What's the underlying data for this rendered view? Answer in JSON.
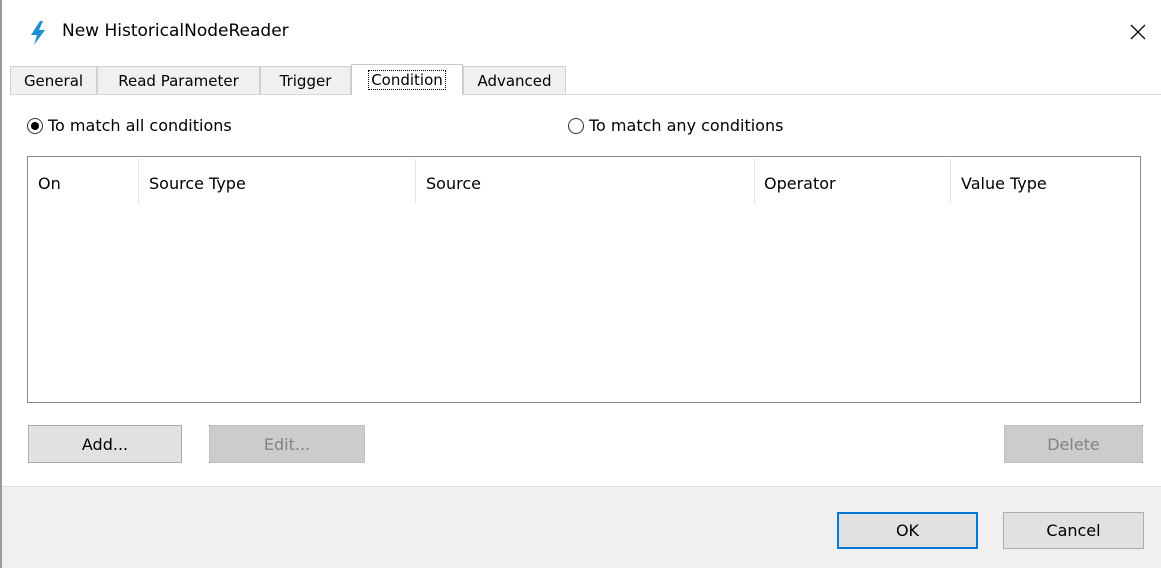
{
  "window": {
    "title": "New HistoricalNodeReader",
    "icon": "lightning-bolt-icon",
    "close_icon": "close-icon",
    "accent_color": "#1e90d2"
  },
  "tabs": [
    {
      "label": "General",
      "active": false
    },
    {
      "label": "Read Parameter",
      "active": false
    },
    {
      "label": "Trigger",
      "active": false
    },
    {
      "label": "Condition",
      "active": true
    },
    {
      "label": "Advanced",
      "active": false
    }
  ],
  "condition": {
    "match_all_label": "To match all conditions",
    "match_any_label": "To match any conditions",
    "selected": "all"
  },
  "grid": {
    "columns": [
      "On",
      "Source Type",
      "Source",
      "Operator",
      "Value Type"
    ],
    "rows": []
  },
  "actions": {
    "add_label": "Add...",
    "edit_label": "Edit...",
    "delete_label": "Delete"
  },
  "footer": {
    "ok_label": "OK",
    "cancel_label": "Cancel"
  }
}
